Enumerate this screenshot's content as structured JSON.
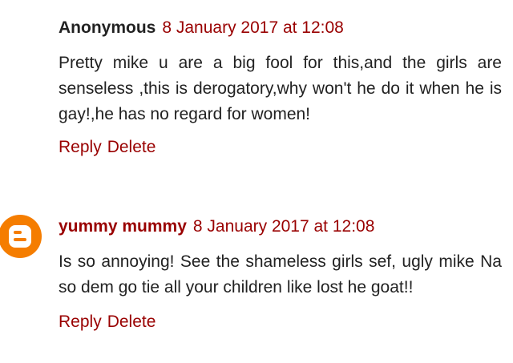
{
  "comments": [
    {
      "author": "Anonymous",
      "date": "8 January 2017 at 12:08",
      "text": "Pretty mike u are a big fool for this,and the girls are senseless ,this is derogatory,why won't he do it when he is gay!,he has no regard for women!",
      "reply_label": "Reply",
      "delete_label": "Delete"
    },
    {
      "author": "yummy mummy",
      "date": "8 January 2017 at 12:08",
      "text": "Is so annoying! See the shameless girls sef, ugly mike Na so dem go tie all your children like lost he goat!!",
      "reply_label": "Reply",
      "delete_label": "Delete",
      "avatar_icon": "blogger-icon"
    }
  ],
  "colors": {
    "link": "#990000",
    "text": "#222222",
    "avatar": "#f57d00"
  }
}
